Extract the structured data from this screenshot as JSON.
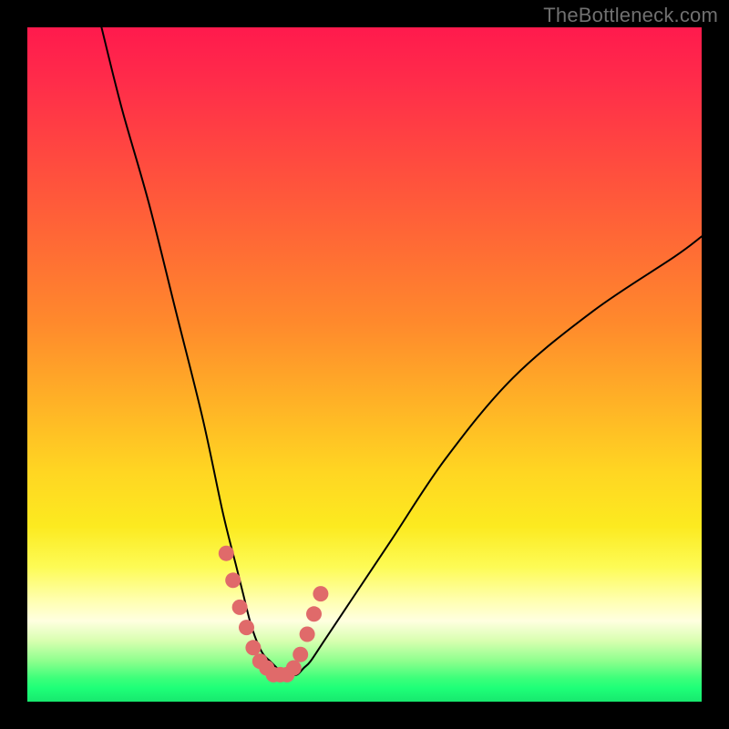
{
  "watermark": "TheBottleneck.com",
  "chart_data": {
    "type": "line",
    "title": "",
    "xlabel": "",
    "ylabel": "",
    "xlim": [
      0,
      100
    ],
    "ylim": [
      0,
      100
    ],
    "grid": false,
    "legend": false,
    "series": [
      {
        "name": "bottleneck-curve",
        "color": "#000000",
        "x": [
          11,
          14,
          18,
          22,
          26,
          29,
          31,
          32,
          33,
          34,
          35,
          36,
          37,
          38,
          39,
          40,
          41,
          42,
          44,
          48,
          54,
          62,
          72,
          84,
          96,
          100
        ],
        "y": [
          100,
          88,
          74,
          58,
          42,
          28,
          20,
          16,
          12,
          9,
          7,
          6,
          5,
          4,
          4,
          4,
          5,
          6,
          9,
          15,
          24,
          36,
          48,
          58,
          66,
          69
        ]
      },
      {
        "name": "highlight-band",
        "color": "#e06a6a",
        "type": "scatter",
        "x": [
          29.5,
          30.5,
          31.5,
          32.5,
          33.5,
          34.5,
          35.5,
          36.5,
          37.5,
          38.5,
          39.5,
          40.5,
          41.5,
          42.5,
          43.5
        ],
        "y": [
          22,
          18,
          14,
          11,
          8,
          6,
          5,
          4,
          4,
          4,
          5,
          7,
          10,
          13,
          16
        ]
      }
    ]
  }
}
